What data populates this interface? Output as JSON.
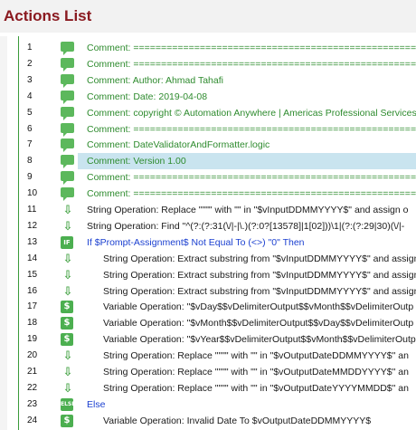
{
  "panel": {
    "title": "Actions List"
  },
  "rows": [
    {
      "num": "1",
      "type": "comment",
      "indent": 0,
      "text": "Comment: ======================================================"
    },
    {
      "num": "2",
      "type": "comment",
      "indent": 0,
      "text": "Comment: ======================================================"
    },
    {
      "num": "3",
      "type": "comment",
      "indent": 0,
      "text": "Comment:  Author: Ahmad Tahafi"
    },
    {
      "num": "4",
      "type": "comment",
      "indent": 0,
      "text": "Comment:  Date: 2019-04-08"
    },
    {
      "num": "5",
      "type": "comment",
      "indent": 0,
      "text": "Comment: copyright © Automation Anywhere | Americas Professional Services"
    },
    {
      "num": "6",
      "type": "comment",
      "indent": 0,
      "text": "Comment: ======================================================"
    },
    {
      "num": "7",
      "type": "comment",
      "indent": 0,
      "text": "Comment:  DateValidatorAndFormatter.logic"
    },
    {
      "num": "8",
      "type": "comment",
      "indent": 0,
      "text": "Comment: Version 1.00",
      "selected": true
    },
    {
      "num": "9",
      "type": "comment",
      "indent": 0,
      "text": "Comment: ======================================================"
    },
    {
      "num": "10",
      "type": "comment",
      "indent": 0,
      "text": "Comment: ======================================================"
    },
    {
      "num": "11",
      "type": "string",
      "indent": 0,
      "text": "String Operation: Replace \"\"\"\" with \"\" in \"$vInputDDMMYYYY$\" and assign o"
    },
    {
      "num": "12",
      "type": "string",
      "indent": 0,
      "text": "String Operation: Find \"^(?:(?:31(\\/|-|\\.)(?:0?[13578]|1[02]))\\1|(?:(?:29|30)(\\/|-"
    },
    {
      "num": "13",
      "type": "if",
      "indent": 0,
      "text": "If $Prompt-Assignment$ Not Equal To (<>) \"0\" Then"
    },
    {
      "num": "14",
      "type": "string",
      "indent": 1,
      "text": "String Operation: Extract substring from \"$vInputDDMMYYYY$\" and assign"
    },
    {
      "num": "15",
      "type": "string",
      "indent": 1,
      "text": "String Operation: Extract substring from \"$vInputDDMMYYYY$\" and assign"
    },
    {
      "num": "16",
      "type": "string",
      "indent": 1,
      "text": "String Operation: Extract substring from \"$vInputDDMMYYYY$\" and assign"
    },
    {
      "num": "17",
      "type": "var",
      "indent": 1,
      "text": "Variable Operation: \"$vDay$$vDelimiterOutput$$vMonth$$vDelimiterOutp"
    },
    {
      "num": "18",
      "type": "var",
      "indent": 1,
      "text": "Variable Operation: \"$vMonth$$vDelimiterOutput$$vDay$$vDelimiterOutp"
    },
    {
      "num": "19",
      "type": "var",
      "indent": 1,
      "text": "Variable Operation: \"$vYear$$vDelimiterOutput$$vMonth$$vDelimiterOutp"
    },
    {
      "num": "20",
      "type": "string",
      "indent": 1,
      "text": "String Operation: Replace \"\"\"\" with \"\" in \"$vOutputDateDDMMYYYY$\" an"
    },
    {
      "num": "21",
      "type": "string",
      "indent": 1,
      "text": "String Operation: Replace \"\"\"\" with \"\" in \"$vOutputDateMMDDYYYY$\" an"
    },
    {
      "num": "22",
      "type": "string",
      "indent": 1,
      "text": "String Operation: Replace \"\"\"\" with \"\" in \"$vOutputDateYYYYMMDD$\" an"
    },
    {
      "num": "23",
      "type": "else",
      "indent": 0,
      "text": "Else"
    },
    {
      "num": "24",
      "type": "var",
      "indent": 1,
      "text": "Variable Operation: Invalid Date To $vOutputDateDDMMYYYY$"
    }
  ],
  "icon_labels": {
    "if": "IF",
    "var": "$",
    "else": "ELSE",
    "string": "⇩"
  },
  "colors": {
    "title": "#8a1a20",
    "comment": "#2e8b2e",
    "keyword": "#1a3fd0",
    "icon": "#4caf50",
    "selected": "#c9e4ef"
  }
}
